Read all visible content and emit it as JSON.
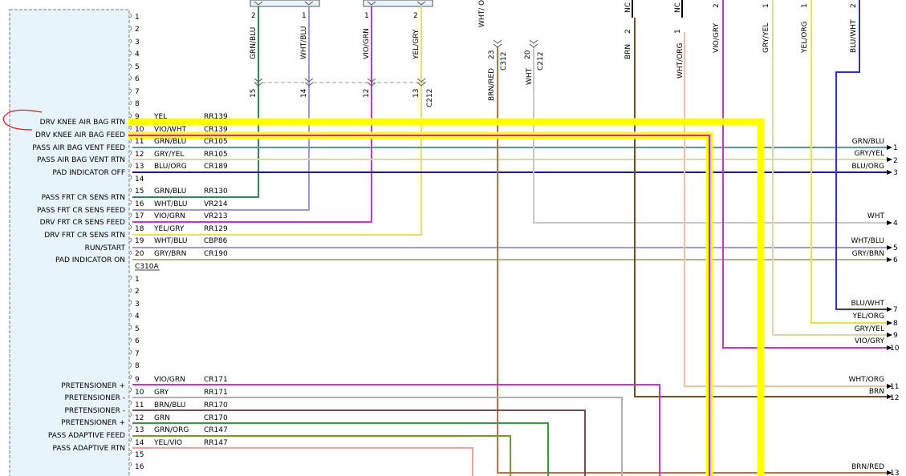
{
  "module": {
    "connector_a": "C310A",
    "labels_a": [
      "DRV KNEE AIR BAG RTN",
      "DRV KNEE AIR BAG FEED",
      "PASS AIR BAG VENT FEED",
      "PASS AIR BAG VENT RTN",
      "PAD INDICATOR OFF",
      "PASS FRT CR SENS RTN",
      "PASS FRT CR SENS FEED",
      "DRV FRT CR SENS FEED",
      "DRV FRT CR SENS RTN",
      "RUN/START",
      "PAD INDICATOR ON"
    ],
    "labels_b": [
      "PRETENSIONER +",
      "PRETENSIONER -",
      "PRETENSIONER -",
      "PRETENSIONER +",
      "PASS ADAPTIVE FEED",
      "PASS ADAPTIVE RTN"
    ],
    "pins_a_top": [
      "1",
      "2",
      "3",
      "4",
      "5",
      "6",
      "7",
      "8"
    ],
    "pins_b_top": [
      "1",
      "2",
      "3",
      "4",
      "5",
      "6",
      "7",
      "8"
    ],
    "pins_b_tail": [
      "15",
      "16"
    ]
  },
  "wires_a": [
    {
      "pin": "9",
      "color": "YEL",
      "circuit": "RR139"
    },
    {
      "pin": "10",
      "color": "VIO/WHT",
      "circuit": "CR139"
    },
    {
      "pin": "11",
      "color": "GRN/BLU",
      "circuit": "CR105"
    },
    {
      "pin": "12",
      "color": "GRY/YEL",
      "circuit": "RR105"
    },
    {
      "pin": "13",
      "color": "BLU/ORG",
      "circuit": "CR189"
    },
    {
      "pin": "14",
      "color": "",
      "circuit": ""
    },
    {
      "pin": "15",
      "color": "GRN/BLU",
      "circuit": "RR130"
    },
    {
      "pin": "16",
      "color": "WHT/BLU",
      "circuit": "VR214"
    },
    {
      "pin": "17",
      "color": "VIO/GRN",
      "circuit": "VR213"
    },
    {
      "pin": "18",
      "color": "YEL/GRY",
      "circuit": "RR129"
    },
    {
      "pin": "19",
      "color": "WHT/BLU",
      "circuit": "CBP86"
    },
    {
      "pin": "20",
      "color": "GRY/BRN",
      "circuit": "CR190"
    }
  ],
  "wires_b": [
    {
      "pin": "9",
      "color": "VIO/GRN",
      "circuit": "CR171"
    },
    {
      "pin": "10",
      "color": "GRY",
      "circuit": "RR171"
    },
    {
      "pin": "11",
      "color": "BRN/BLU",
      "circuit": "RR170"
    },
    {
      "pin": "12",
      "color": "GRN",
      "circuit": "CR170"
    },
    {
      "pin": "13",
      "color": "GRN/ORG",
      "circuit": "CR147"
    },
    {
      "pin": "14",
      "color": "YEL/VIO",
      "circuit": "RR147"
    }
  ],
  "top_connector": {
    "wires": [
      {
        "color": "GRN/BLU",
        "pin_upper": "2",
        "pin_lower": "15"
      },
      {
        "color": "WHT/BLU",
        "pin_upper": "1",
        "pin_lower": "14"
      },
      {
        "color": "VIO/GRN",
        "pin_upper": "1",
        "pin_lower": "12"
      },
      {
        "color": "YEL/GRY",
        "pin_upper": "2",
        "pin_lower": "13"
      }
    ],
    "connector": "C212"
  },
  "mid_wires": {
    "wht_org": {
      "color": "WHT/ ORG",
      "pin": "23",
      "connector": "C312",
      "below": "BRN/RED"
    },
    "wht": {
      "color": "WHT",
      "pin": "20",
      "connector": "C212"
    },
    "brn": {
      "nc": "NC",
      "pin": "2",
      "color": "BRN"
    },
    "wht_org2": {
      "nc": "NC",
      "pin": "1",
      "color": "WHT/ORG"
    },
    "vio_gry": {
      "pin": "2",
      "color": "VIO/GRY"
    },
    "gry_yel": {
      "pin": "1",
      "color": "GRY/YEL"
    },
    "yel_org": {
      "pin": "1",
      "color": "YEL/ORG"
    },
    "blu_wht": {
      "pin": "2",
      "color": "BLU/WHT"
    }
  },
  "right_pins": [
    {
      "pin": "1",
      "color": "GRN/BLU"
    },
    {
      "pin": "2",
      "color": "GRY/YEL"
    },
    {
      "pin": "3",
      "color": "BLU/ORG"
    },
    {
      "pin": "4",
      "color": "WHT"
    },
    {
      "pin": "5",
      "color": "WHT/BLU"
    },
    {
      "pin": "6",
      "color": "GRY/BRN"
    },
    {
      "pin": "7",
      "color": "BLU/WHT"
    },
    {
      "pin": "8",
      "color": "YEL/ORG"
    },
    {
      "pin": "9",
      "color": "GRY/YEL"
    },
    {
      "pin": "10",
      "color": "VIO/GRY"
    },
    {
      "pin": "11",
      "color": "WHT/ORG"
    },
    {
      "pin": "12",
      "color": "BRN"
    },
    {
      "pin": "13",
      "color": "BRN/RED"
    }
  ],
  "colors": {
    "highlight": "#ffff00",
    "highlight_magenta": "#ff00ff",
    "module_fill": "#e8f4fc"
  }
}
